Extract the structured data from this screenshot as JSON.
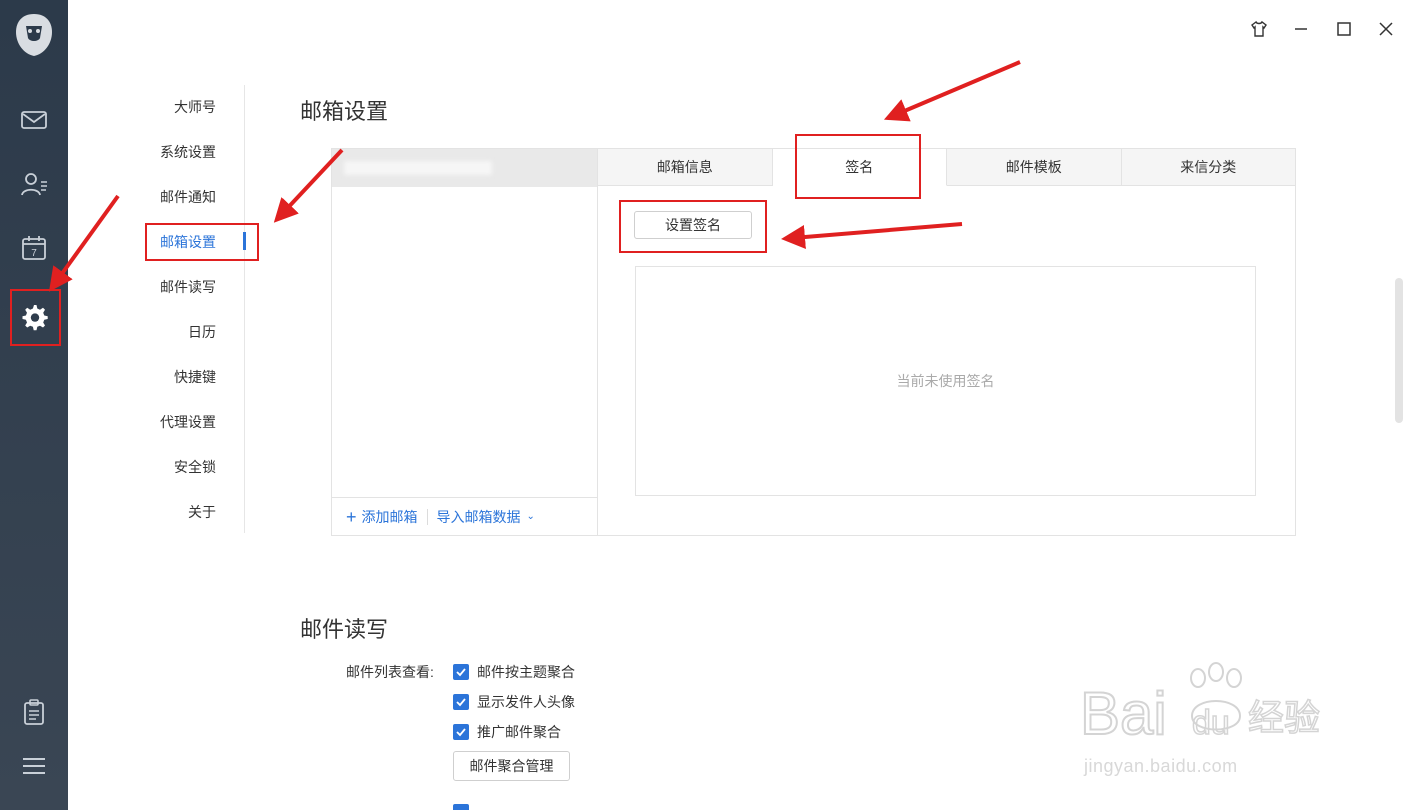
{
  "sidebar_rail": {
    "items": [
      "mail-icon",
      "contacts-icon",
      "calendar-icon",
      "settings-icon"
    ],
    "calendar_day": "7",
    "bottom": [
      "clipboard-icon",
      "menu-icon"
    ]
  },
  "settings_nav": {
    "items": [
      "大师号",
      "系统设置",
      "邮件通知",
      "邮箱设置",
      "邮件读写",
      "日历",
      "快捷键",
      "代理设置",
      "安全锁",
      "关于"
    ],
    "active_index": 3
  },
  "mailbox_settings": {
    "title": "邮箱设置",
    "tabs": [
      "邮箱信息",
      "签名",
      "邮件模板",
      "来信分类"
    ],
    "active_tab": "签名",
    "set_signature_button": "设置签名",
    "empty_signature_text": "当前未使用签名",
    "add_mailbox": "添加邮箱",
    "import_data": "导入邮箱数据"
  },
  "mail_read_write": {
    "title": "邮件读写",
    "list_view_label": "邮件列表查看:",
    "options": [
      "邮件按主题聚合",
      "显示发件人头像",
      "推广邮件聚合"
    ],
    "aggregate_manage_button": "邮件聚合管理"
  },
  "watermark": {
    "brand": "Bai",
    "brand2": "du",
    "cn": "经验",
    "url": "jingyan.baidu.com"
  },
  "colors": {
    "accent": "#2b74d9",
    "annotation": "#e02020",
    "rail": "#2c3a4a"
  }
}
